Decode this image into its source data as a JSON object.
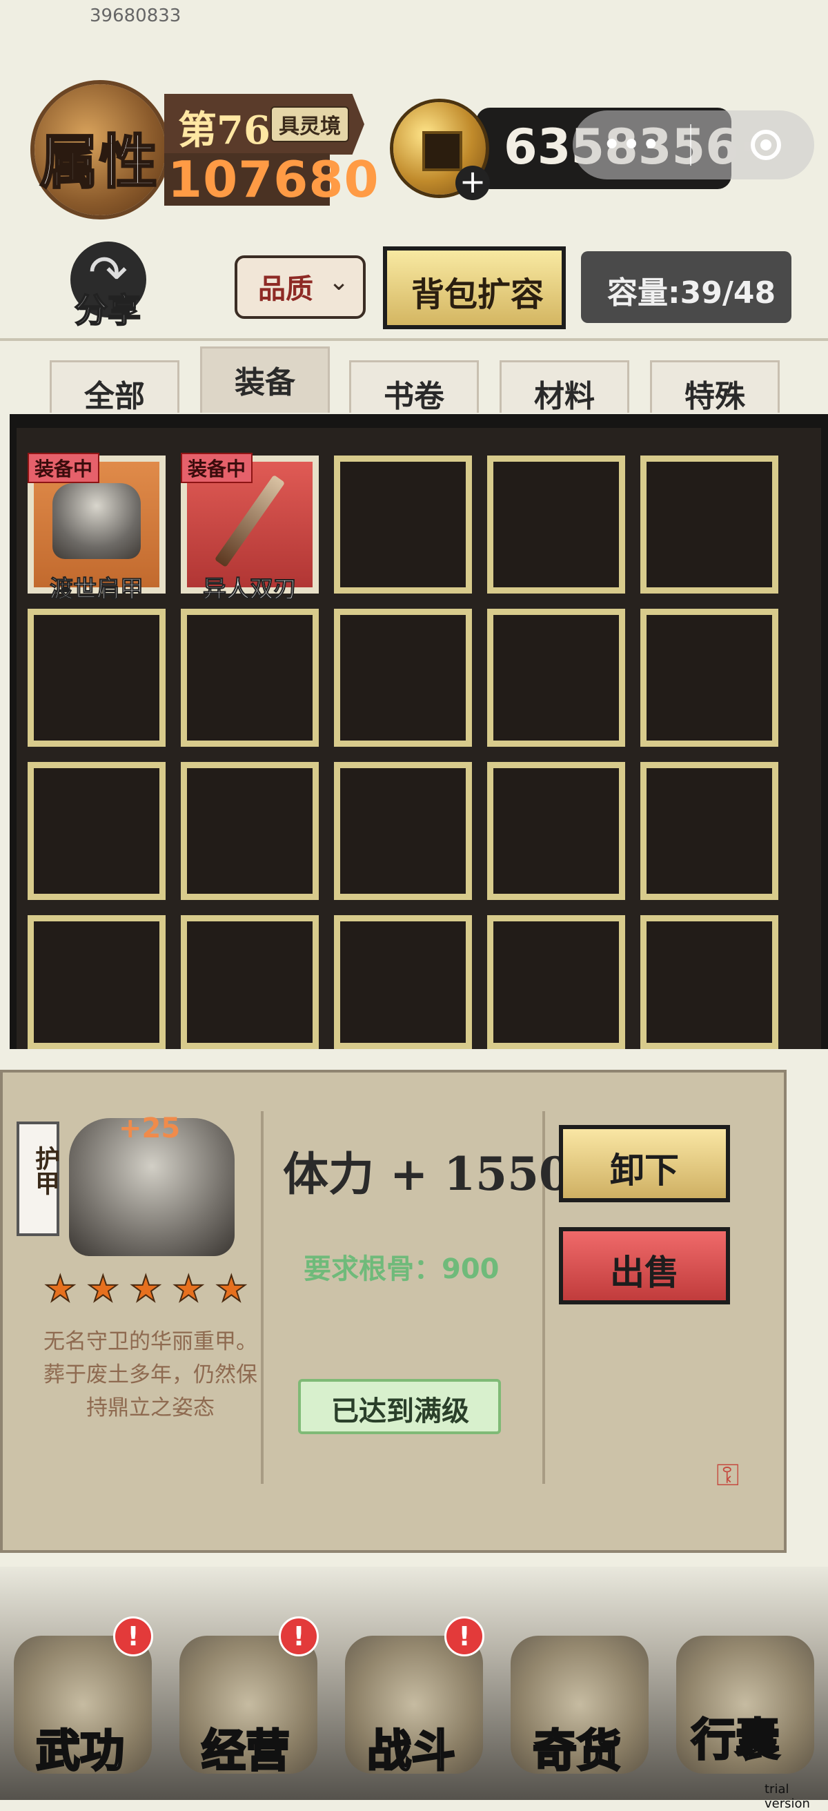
{
  "header": {
    "user_id": "39680833",
    "attr_label": "属性",
    "level": "第76",
    "realm": "具灵境",
    "power": "107680",
    "currency": "6358356·"
  },
  "toolbar": {
    "share_label": "分享",
    "quality_label": "品质",
    "expand_label": "背包扩容",
    "capacity_label": "容量:39/48"
  },
  "tabs": [
    {
      "label": "全部"
    },
    {
      "label": "装备"
    },
    {
      "label": "书卷"
    },
    {
      "label": "材料"
    },
    {
      "label": "特殊"
    }
  ],
  "items": [
    {
      "name": "渡世肩甲",
      "badge": "装备中"
    },
    {
      "name": "异人双刃",
      "badge": "装备中"
    }
  ],
  "detail": {
    "type": "护甲",
    "plus": "+25",
    "stars": 5,
    "description": "无名守卫的华丽重甲。葬于废土多年，仍然保持鼎立之姿态",
    "stat": "体力 + 1550",
    "requirement": "要求根骨：900",
    "max_status": "已达到满级",
    "unequip_label": "卸下",
    "sell_label": "出售"
  },
  "nav": [
    {
      "label": "武功",
      "alert": "!"
    },
    {
      "label": "经营",
      "alert": "!"
    },
    {
      "label": "战斗",
      "alert": "!"
    },
    {
      "label": "奇货",
      "alert": ""
    },
    {
      "label": "行囊",
      "alert": ""
    }
  ],
  "footer": {
    "trial": "trial version"
  }
}
